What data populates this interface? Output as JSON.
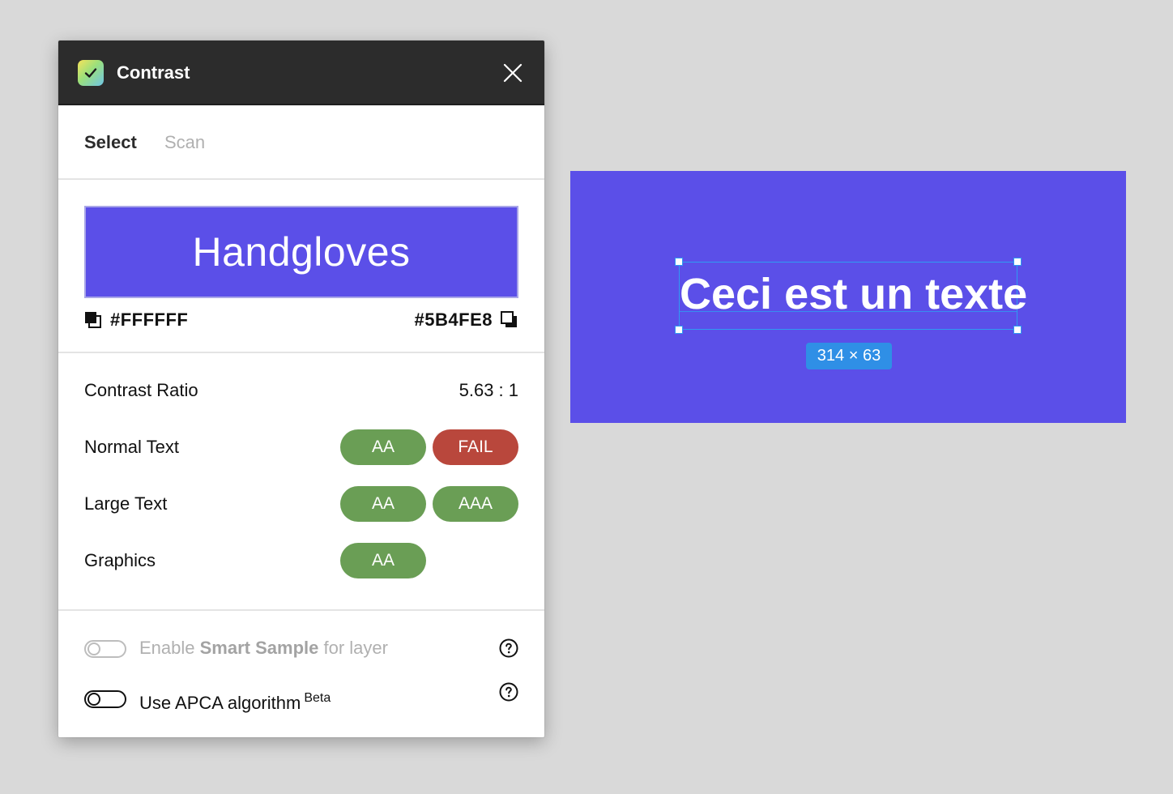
{
  "panel": {
    "title": "Contrast",
    "logo_icon": "check-icon",
    "tabs": [
      {
        "label": "Select",
        "active": true
      },
      {
        "label": "Scan",
        "active": false
      }
    ],
    "preview": {
      "sample_text": "Handgloves",
      "foreground_hex": "#FFFFFF",
      "background_hex": "#5B4FE8"
    },
    "results": {
      "ratio_label": "Contrast Ratio",
      "ratio_value": "5.63 : 1",
      "normal_text": {
        "label": "Normal Text",
        "badges": [
          "AA",
          "FAIL"
        ]
      },
      "large_text": {
        "label": "Large Text",
        "badges": [
          "AA",
          "AAA"
        ]
      },
      "graphics": {
        "label": "Graphics",
        "badges": [
          "AA"
        ]
      }
    },
    "options": {
      "smart_sample": {
        "prefix": "Enable ",
        "bold": "Smart Sample",
        "suffix": " for layer",
        "enabled": false
      },
      "apca": {
        "label": "Use APCA algorithm",
        "superscript": "Beta",
        "enabled": true
      }
    }
  },
  "canvas": {
    "layer_text": "Ceci est un texte",
    "dimensions": "314 × 63",
    "frame_color": "#5B4FE8",
    "selection_color": "#2F9BF3"
  },
  "colors": {
    "pass": "#6A9E55",
    "fail": "#B9473C",
    "titlebar": "#2C2C2C"
  }
}
